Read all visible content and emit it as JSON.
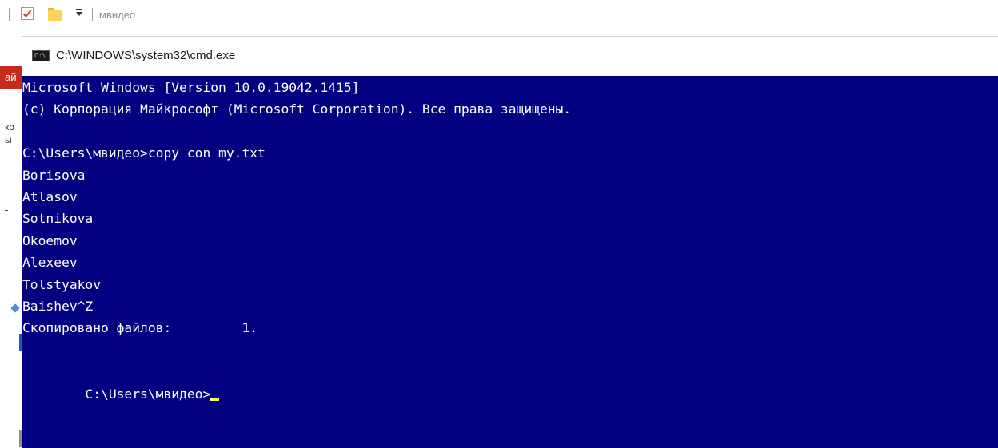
{
  "explorer": {
    "quick_access": {
      "icons": [
        "checkbox-icon",
        "folder-icon",
        "dropdown-arrow-icon"
      ]
    },
    "title": "мвидео",
    "side_fragments": [
      "ай",
      "кр",
      "ы"
    ]
  },
  "cmd": {
    "title": "C:\\WINDOWS\\system32\\cmd.exe",
    "icon_text": "C:\\",
    "lines": [
      "Microsoft Windows [Version 10.0.19042.1415]",
      "(c) Корпорация Майкрософт (Microsoft Corporation). Все права защищены.",
      "",
      "C:\\Users\\мвидео>copy con my.txt",
      "Borisova",
      "Atlasov",
      "Sotnikova",
      "Okoemov",
      "Alexeev",
      "Tolstyakov",
      "Baishev^Z",
      "Скопировано файлов:         1.",
      ""
    ],
    "prompt": "C:\\Users\\мвидео>",
    "colors": {
      "background": "#000080",
      "foreground": "#ffffff",
      "cursor": "#ffff60"
    }
  }
}
